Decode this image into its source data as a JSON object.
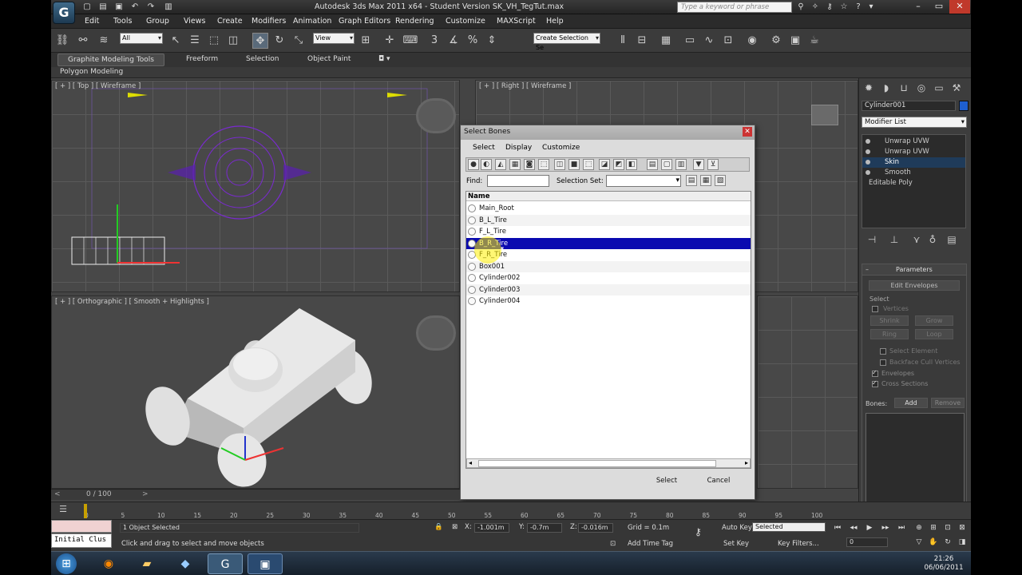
{
  "window": {
    "title": "Autodesk 3ds Max  2011 x64  -  Student Version    SK_VH_TegTut.max",
    "search_placeholder": "Type a keyword or phrase"
  },
  "menu": [
    "Edit",
    "Tools",
    "Group",
    "Views",
    "Create",
    "Modifiers",
    "Animation",
    "Graph Editors",
    "Rendering",
    "Customize",
    "MAXScript",
    "Help"
  ],
  "toolbar": {
    "filter": "All",
    "coord": "View",
    "selection_set": "Create Selection Se",
    "snap_label": "3"
  },
  "ribbon": {
    "tabs": [
      "Graphite Modeling Tools",
      "Freeform",
      "Selection",
      "Object Paint"
    ],
    "sub": "Polygon Modeling"
  },
  "viewports": {
    "top": "[ + ] [ Top ] [ Wireframe ]",
    "right": "[ + ] [ Right ] [ Wireframe ]",
    "perspective": "[ + ] [ Orthographic ] [ Smooth + Highlights ]"
  },
  "dialog": {
    "title": "Select Bones",
    "menus": [
      "Select",
      "Display",
      "Customize"
    ],
    "find_label": "Find:",
    "selset_label": "Selection Set:",
    "list_header": "Name",
    "items": [
      "Main_Root",
      "B_L_Tire",
      "F_L_Tire",
      "B_R_Tire",
      "F_R_Tire",
      "Box001",
      "Cylinder002",
      "Cylinder003",
      "Cylinder004"
    ],
    "selected_index": 3,
    "buttons": {
      "select": "Select",
      "cancel": "Cancel"
    }
  },
  "command_panel": {
    "object_name": "Cylinder001",
    "object_color": "#1e5fd0",
    "modifier_list": "Modifier List",
    "stack": [
      "Unwrap UVW",
      "Unwrap UVW",
      "Skin",
      "Smooth",
      "Editable Poly"
    ],
    "stack_selected": 2,
    "parameters": {
      "title": "Parameters",
      "edit_envelopes": "Edit Envelopes",
      "select_group": "Select",
      "vertices": "Vertices",
      "shrink": "Shrink",
      "grow": "Grow",
      "ring": "Ring",
      "loop": "Loop",
      "select_element": "Select Element",
      "backface": "Backface Cull Vertices",
      "envelopes": "Envelopes",
      "cross_sections": "Cross Sections",
      "bones_label": "Bones:",
      "add": "Add",
      "remove": "Remove"
    }
  },
  "timeline": {
    "frame": "0 / 100",
    "ticks": [
      "0",
      "5",
      "10",
      "15",
      "20",
      "25",
      "30",
      "35",
      "40",
      "45",
      "50",
      "55",
      "60",
      "65",
      "70",
      "75",
      "80",
      "85",
      "90",
      "95",
      "100"
    ]
  },
  "status": {
    "maxscript": "Initial Clus",
    "selected": "1 Object Selected",
    "prompt": "Click and drag to select and move objects",
    "x": "-1.001m",
    "y": "-0.7m",
    "z": "-0.016m",
    "grid": "Grid = 0.1m",
    "add_time_tag": "Add Time Tag",
    "auto_key": "Auto Key",
    "auto_key_value": "Selected",
    "set_key": "Set Key",
    "key_filters": "Key Filters...",
    "frame_field": "0"
  },
  "taskbar": {
    "time": "21:26",
    "date": "06/06/2011"
  }
}
